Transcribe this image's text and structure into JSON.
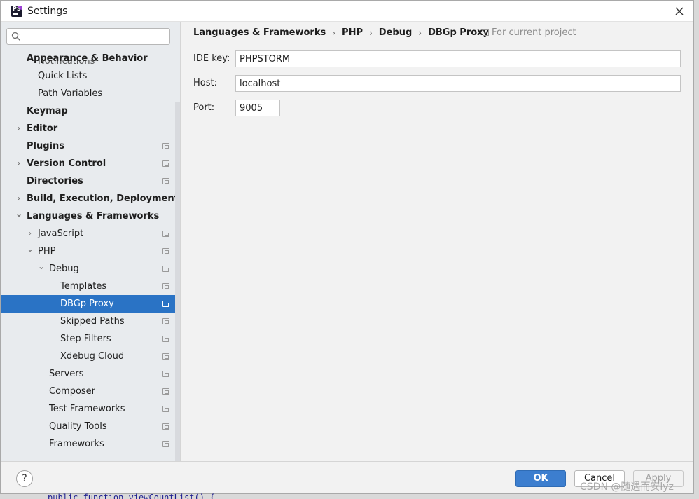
{
  "window": {
    "title": "Settings",
    "logo_text": "PS"
  },
  "search": {
    "placeholder": "",
    "value": ""
  },
  "sidebar": {
    "partial_top_label": "Notifications",
    "items": [
      {
        "label": "Appearance & Behavior",
        "bold": true,
        "level": 0,
        "arrow": "",
        "proj": false
      },
      {
        "label": "Quick Lists",
        "bold": false,
        "level": 1,
        "arrow": "",
        "proj": false
      },
      {
        "label": "Path Variables",
        "bold": false,
        "level": 1,
        "arrow": "",
        "proj": false
      },
      {
        "label": "Keymap",
        "bold": true,
        "level": 0,
        "arrow": "",
        "proj": false
      },
      {
        "label": "Editor",
        "bold": true,
        "level": 0,
        "arrow": "›",
        "proj": false
      },
      {
        "label": "Plugins",
        "bold": true,
        "level": 0,
        "arrow": "",
        "proj": true
      },
      {
        "label": "Version Control",
        "bold": true,
        "level": 0,
        "arrow": "›",
        "proj": true
      },
      {
        "label": "Directories",
        "bold": true,
        "level": 0,
        "arrow": "",
        "proj": true
      },
      {
        "label": "Build, Execution, Deployment",
        "bold": true,
        "level": 0,
        "arrow": "›",
        "proj": false
      },
      {
        "label": "Languages & Frameworks",
        "bold": true,
        "level": 0,
        "arrow": "⌄",
        "proj": false
      },
      {
        "label": "JavaScript",
        "bold": false,
        "level": 1,
        "arrow": "›",
        "proj": true
      },
      {
        "label": "PHP",
        "bold": false,
        "level": 1,
        "arrow": "⌄",
        "proj": true
      },
      {
        "label": "Debug",
        "bold": false,
        "level": 2,
        "arrow": "⌄",
        "proj": true
      },
      {
        "label": "Templates",
        "bold": false,
        "level": 3,
        "arrow": "",
        "proj": true
      },
      {
        "label": "DBGp Proxy",
        "bold": false,
        "level": 3,
        "arrow": "",
        "proj": true,
        "selected": true
      },
      {
        "label": "Skipped Paths",
        "bold": false,
        "level": 3,
        "arrow": "",
        "proj": true
      },
      {
        "label": "Step Filters",
        "bold": false,
        "level": 3,
        "arrow": "",
        "proj": true
      },
      {
        "label": "Xdebug Cloud",
        "bold": false,
        "level": 3,
        "arrow": "",
        "proj": true
      },
      {
        "label": "Servers",
        "bold": false,
        "level": 2,
        "arrow": "",
        "proj": true
      },
      {
        "label": "Composer",
        "bold": false,
        "level": 2,
        "arrow": "",
        "proj": true
      },
      {
        "label": "Test Frameworks",
        "bold": false,
        "level": 2,
        "arrow": "",
        "proj": true
      },
      {
        "label": "Quality Tools",
        "bold": false,
        "level": 2,
        "arrow": "",
        "proj": true
      },
      {
        "label": "Frameworks",
        "bold": false,
        "level": 2,
        "arrow": "",
        "proj": true
      }
    ]
  },
  "breadcrumb": {
    "items": [
      "Languages & Frameworks",
      "PHP",
      "Debug",
      "DBGp Proxy"
    ],
    "separator": "›",
    "scope_label": "For current project"
  },
  "form": {
    "ide_key": {
      "label": "IDE key:",
      "value": "PHPSTORM"
    },
    "host": {
      "label": "Host:",
      "value": "localhost"
    },
    "port": {
      "label": "Port:",
      "value": "9005"
    }
  },
  "footer": {
    "help_label": "?",
    "ok_label": "OK",
    "cancel_label": "Cancel",
    "apply_label": "Apply"
  },
  "background": {
    "code_snippet": "public function  viewCountList() {",
    "watermark": "CSDN @随遇而安lyz"
  },
  "colors": {
    "selection": "#2a73c5",
    "ok_button": "#3c7ecf",
    "sidebar_bg": "#e8ebee"
  }
}
